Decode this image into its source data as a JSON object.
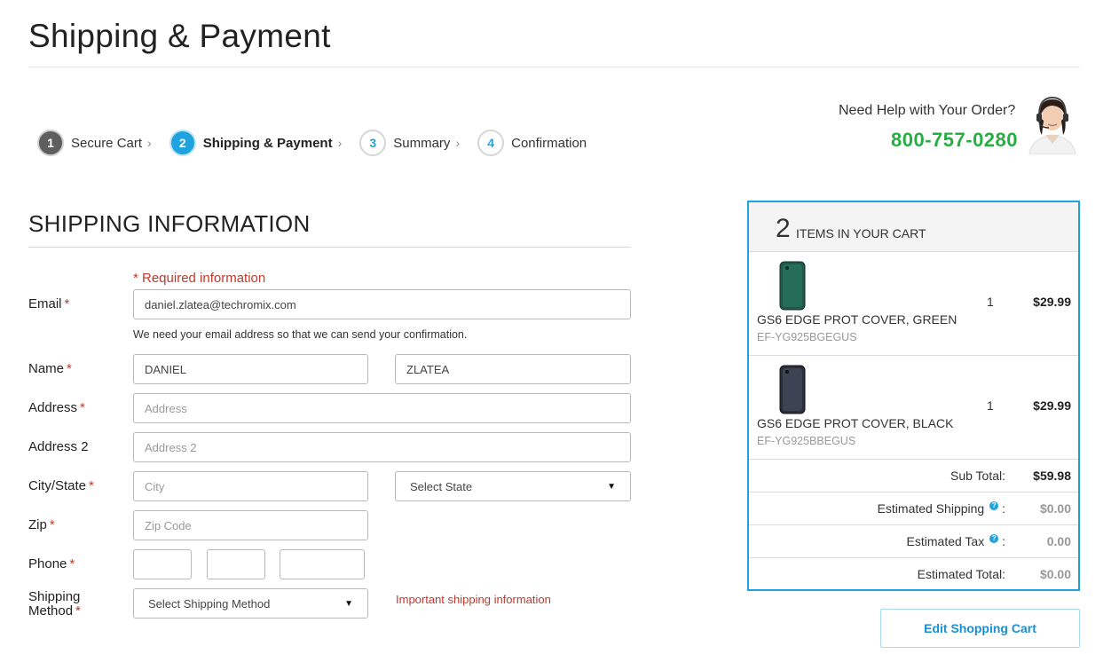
{
  "page": {
    "title": "Shipping & Payment"
  },
  "steps": [
    {
      "num": "1",
      "label": "Secure Cart",
      "state": "done"
    },
    {
      "num": "2",
      "label": "Shipping & Payment",
      "state": "active"
    },
    {
      "num": "3",
      "label": "Summary",
      "state": "todo"
    },
    {
      "num": "4",
      "label": "Confirmation",
      "state": "todo"
    }
  ],
  "help": {
    "text": "Need Help with Your Order?",
    "phone": "800-757-0280"
  },
  "shipping": {
    "title": "SHIPPING INFORMATION",
    "required_note": "* Required information",
    "labels": {
      "email": "Email",
      "name": "Name",
      "address": "Address",
      "address2": "Address 2",
      "city_state": "City/State",
      "zip": "Zip",
      "phone": "Phone",
      "shipping_method_1": "Shipping",
      "shipping_method_2": "Method"
    },
    "required_star": "*",
    "email_value": "daniel.zlatea@techromix.com",
    "email_hint": "We need your email address so that we can send your confirmation.",
    "first_name_value": "DANIEL",
    "last_name_value": "ZLATEA",
    "address_placeholder": "Address",
    "address2_placeholder": "Address 2",
    "city_placeholder": "City",
    "state_select": "Select State",
    "zip_placeholder": "Zip Code",
    "shipping_method_select": "Select Shipping Method",
    "shipping_note": "Important shipping information"
  },
  "cart": {
    "count": "2",
    "header_label": "ITEMS IN YOUR CART",
    "items": [
      {
        "name": "GS6 EDGE PROT COVER, GREEN",
        "sku": "EF-YG925BGEGUS",
        "qty": "1",
        "price": "$29.99",
        "color": "#1f5a48"
      },
      {
        "name": "GS6 EDGE PROT COVER, BLACK",
        "sku": "EF-YG925BBEGUS",
        "qty": "1",
        "price": "$29.99",
        "color": "#2a2f3a"
      }
    ],
    "summary": [
      {
        "label": "Sub Total:",
        "value": "$59.98",
        "help": false,
        "muted": false
      },
      {
        "label": "Estimated Shipping",
        "value": "$0.00",
        "help": true,
        "muted": true
      },
      {
        "label": "Estimated Tax",
        "value": "0.00",
        "help": true,
        "muted": true
      },
      {
        "label": "Estimated Total:",
        "value": "$0.00",
        "help": false,
        "muted": true
      }
    ],
    "help_mark": "?",
    "help_colon": ":",
    "edit_button": "Edit Shopping Cart"
  },
  "colors": {
    "accent": "#1fa3de",
    "phone_green": "#27ae43",
    "required_red": "#c0392b"
  }
}
